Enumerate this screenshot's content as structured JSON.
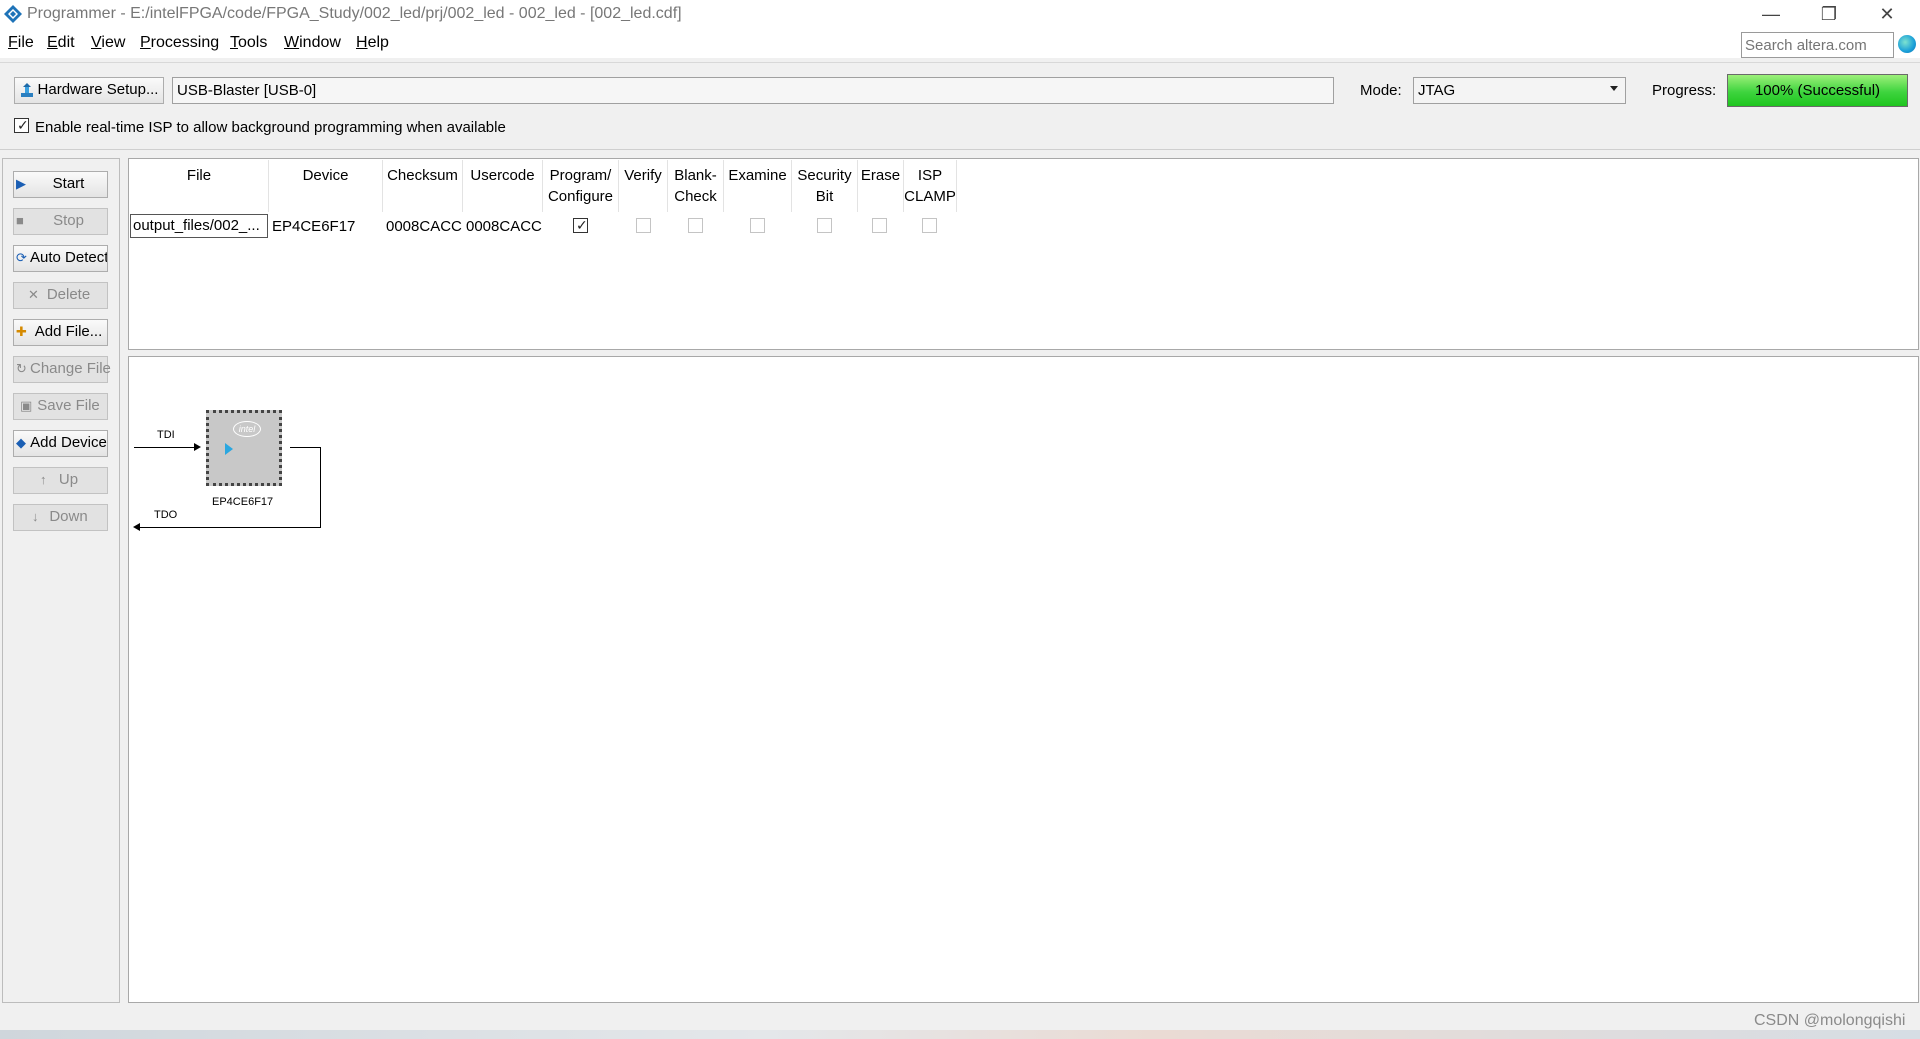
{
  "window": {
    "title": "Programmer - E:/intelFPGA/code/FPGA_Study/002_led/prj/002_led - 002_led - [002_led.cdf]",
    "minimize": "—",
    "restore": "❐",
    "close": "✕"
  },
  "menu": {
    "items": [
      {
        "label": "File",
        "mnemonic": "F",
        "rest": "ile"
      },
      {
        "label": "Edit",
        "mnemonic": "E",
        "rest": "dit"
      },
      {
        "label": "View",
        "mnemonic": "V",
        "rest": "iew"
      },
      {
        "label": "Processing",
        "mnemonic": "P",
        "rest": "rocessing"
      },
      {
        "label": "Tools",
        "mnemonic": "T",
        "rest": "ools"
      },
      {
        "label": "Window",
        "mnemonic": "W",
        "rest": "indow"
      },
      {
        "label": "Help",
        "mnemonic": "H",
        "rest": "elp"
      }
    ],
    "search_placeholder": "Search altera.com"
  },
  "toolbar": {
    "hardware_setup_label": "Hardware Setup...",
    "hardware_value": "USB-Blaster [USB-0]",
    "mode_label": "Mode:",
    "mode_value": "JTAG",
    "progress_label": "Progress:",
    "progress_text": "100% (Successful)",
    "progress_percent": 100,
    "progress_color": "#3ed43e",
    "isp_checked": true,
    "isp_label": "Enable real-time ISP to allow background programming when available"
  },
  "side_buttons": [
    {
      "label": "Start",
      "icon": "start-icon",
      "enabled": true
    },
    {
      "label": "Stop",
      "icon": "stop-icon",
      "enabled": false
    },
    {
      "label": "Auto Detect",
      "icon": "auto-detect-icon",
      "enabled": true
    },
    {
      "label": "Delete",
      "icon": "delete-icon",
      "enabled": false
    },
    {
      "label": "Add File...",
      "icon": "add-file-icon",
      "enabled": true
    },
    {
      "label": "Change File",
      "icon": "change-file-icon",
      "enabled": false
    },
    {
      "label": "Save File",
      "icon": "save-file-icon",
      "enabled": false
    },
    {
      "label": "Add Device",
      "icon": "add-device-icon",
      "enabled": true
    },
    {
      "label": "Up",
      "icon": "up-icon",
      "enabled": false
    },
    {
      "label": "Down",
      "icon": "down-icon",
      "enabled": false
    }
  ],
  "table": {
    "headers": [
      "File",
      "Device",
      "Checksum",
      "Usercode",
      "Program/\nConfigure",
      "Verify",
      "Blank-\nCheck",
      "Examine",
      "Security\nBit",
      "Erase",
      "ISP\nCLAMP"
    ],
    "rows": [
      {
        "file": "output_files/002_...",
        "device": "EP4CE6F17",
        "checksum": "0008CACC",
        "usercode": "0008CACC",
        "program_configure": true,
        "verify": false,
        "blank_check": false,
        "examine": false,
        "security_bit": false,
        "erase": false,
        "isp_clamp": false
      }
    ]
  },
  "chain": {
    "tdi_label": "TDI",
    "tdo_label": "TDO",
    "device_label": "EP4CE6F17",
    "logo_text": "intel"
  },
  "watermark": "CSDN @molongqishi"
}
